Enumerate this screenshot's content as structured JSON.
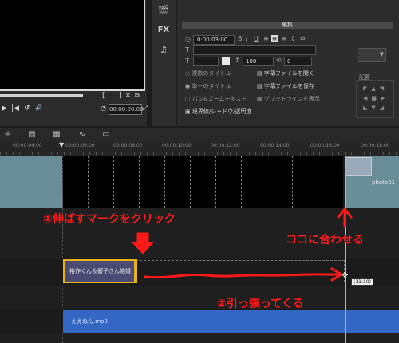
{
  "preview": {
    "mark_in": "[",
    "mark_out": "]",
    "timecode": "00:00:00.00",
    "controls": [
      "▶",
      "|◀",
      "↺",
      "🔊"
    ]
  },
  "tool_rail": {
    "items": [
      "",
      "FX",
      "♫"
    ]
  },
  "edit_panel": {
    "tab_label": "編集",
    "duration": "0:00:03:00",
    "font_size": "100",
    "angle": "0",
    "subtitle_open": "字幕ファイルを開く",
    "subtitle_save": "字幕ファイルを保存",
    "border_shadow": "境界線/シャドウ/透明度",
    "position_label": "配置",
    "row_labels": [
      "複数のタイトル",
      "単一のタイトル",
      "パン&ズームテキスト",
      "グリッドラインを表示"
    ]
  },
  "ruler": {
    "ticks": [
      "00:00:04:00",
      "00:00:06:00",
      "00:00:08:00",
      "00:00:10:00",
      "00:00:12:00",
      "00:00:14:00",
      "00:00:16:00",
      "00:00:18:00"
    ]
  },
  "tracks": {
    "photo_clip_name": "photo01",
    "title_clip_text": "裕作くん＆響子さん結婚",
    "audio_clip_name": "ええねん.mp3",
    "tooltip": "(11:10)"
  },
  "annotations": {
    "step1": "①伸ばすマークをクリック",
    "step2": "②引っ張ってくる",
    "align_here": "ココに合わせる"
  },
  "colors": {
    "annotation": "#ff1a1a",
    "title_clip": "#4a4a75",
    "title_border": "#e8b21a",
    "audio_clip": "#3466c3",
    "video_track_header": "#6a8e98"
  }
}
